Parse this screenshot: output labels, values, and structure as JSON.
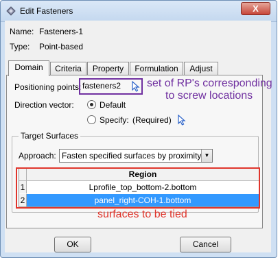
{
  "window": {
    "title": "Edit Fasteners",
    "close_symbol": "X"
  },
  "info": {
    "name_label": "Name:",
    "name_value": "Fasteners-1",
    "type_label": "Type:",
    "type_value": "Point-based"
  },
  "tabs": [
    {
      "label": "Domain"
    },
    {
      "label": "Criteria"
    },
    {
      "label": "Property"
    },
    {
      "label": "Formulation"
    },
    {
      "label": "Adjust"
    }
  ],
  "domain": {
    "positioning_label": "Positioning points:",
    "positioning_value": "fasteners2",
    "direction_label": "Direction vector:",
    "default_option": "Default",
    "specify_option": "Specify:",
    "specify_status": "(Required)"
  },
  "target": {
    "group_title": "Target Surfaces",
    "approach_label": "Approach:",
    "approach_value": "Fasten specified surfaces by proximity",
    "region_header": "Region",
    "rows": [
      {
        "num": "1",
        "value": "Lprofile_top_bottom-2.bottom"
      },
      {
        "num": "2",
        "value": "panel_right-COH-1.bottom"
      }
    ]
  },
  "annotations": {
    "purple_line1": "set of RP's corresponding",
    "purple_line2": "to screw locations",
    "red": "surfaces to be tied"
  },
  "buttons": {
    "ok": "OK",
    "cancel": "Cancel"
  },
  "colors": {
    "annotation_purple": "#7030a0",
    "annotation_red": "#e0352b",
    "selection": "#3399ff"
  }
}
